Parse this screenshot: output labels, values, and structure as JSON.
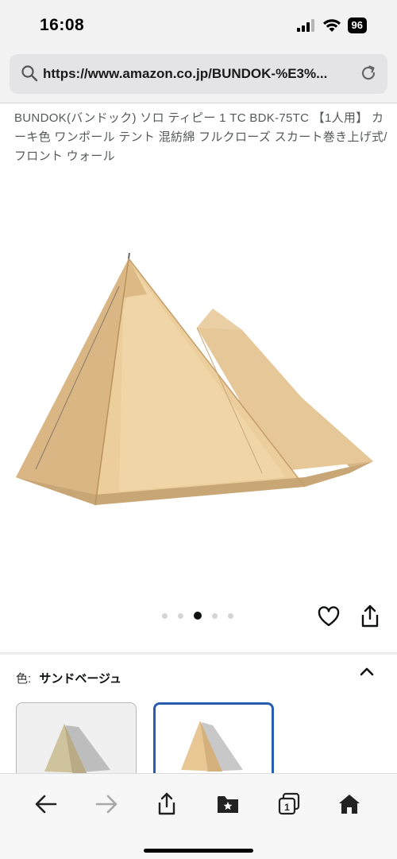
{
  "status_bar": {
    "time": "16:08",
    "battery": "96",
    "icons": [
      "cellular-signal-icon",
      "wifi-icon",
      "battery-icon"
    ]
  },
  "browser": {
    "url": "https://www.amazon.co.jp/BUNDOK-%E3%...",
    "icons": [
      "search-icon",
      "reload-icon"
    ]
  },
  "product": {
    "title": "BUNDOK(バンドック) ソロ ティピー 1 TC BDK-75TC 【1人用】 カーキ色 ワンポール テント 混紡綿 フルクローズ スカート巻き上げ式/フロント ウォール"
  },
  "carousel": {
    "total_images": 5,
    "active_index": 2,
    "actions": [
      "heart-icon",
      "share-icon"
    ]
  },
  "color_selector": {
    "label": "色:",
    "selected": "サンドベージュ",
    "selected_index": 1
  },
  "toolbar": {
    "items": [
      "back-arrow-icon",
      "forward-arrow-icon",
      "share-icon",
      "bookmarks-icon",
      "tabs-icon",
      "home-icon"
    ],
    "tab_count": "1"
  },
  "colors": {
    "tent_sand": "#e8c795",
    "tent_khaki": "#cdbf98",
    "selection_border": "#2a5db0"
  }
}
